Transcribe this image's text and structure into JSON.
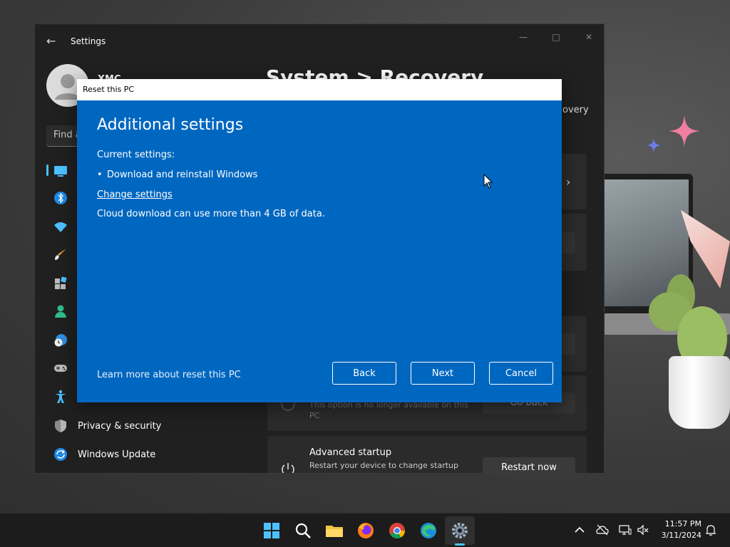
{
  "settings": {
    "title": "Settings",
    "user_name": "XMC",
    "search_placeholder": "Find a",
    "page_title": "System  >  Recovery",
    "breadcrumb_tail": "overy",
    "nav": [
      {
        "label": "",
        "icon": "system-icon"
      },
      {
        "label": "",
        "icon": "bluetooth-icon"
      },
      {
        "label": "",
        "icon": "wifi-icon"
      },
      {
        "label": "",
        "icon": "personalization-icon"
      },
      {
        "label": "",
        "icon": "apps-icon"
      },
      {
        "label": "",
        "icon": "accounts-icon"
      },
      {
        "label": "",
        "icon": "time-language-icon"
      },
      {
        "label": "",
        "icon": "gaming-icon"
      },
      {
        "label": "",
        "icon": "accessibility-icon"
      },
      {
        "label": "Privacy & security",
        "icon": "shield-icon"
      },
      {
        "label": "Windows Update",
        "icon": "windows-update-icon"
      }
    ],
    "go_back": {
      "desc": "This option is no longer available on this PC",
      "button": "Go back"
    },
    "advanced_startup": {
      "title": "Advanced startup",
      "desc": "Restart your device to change startup settings, including starting from a disc",
      "button": "Restart now"
    }
  },
  "dialog": {
    "title": "Reset this PC",
    "heading": "Additional settings",
    "current_label": "Current settings:",
    "bullet": "Download and reinstall Windows",
    "change_link": "Change settings",
    "cloud_note": "Cloud download can use more than 4 GB of data.",
    "learn_link": "Learn more about reset this PC",
    "buttons": {
      "back": "Back",
      "next": "Next",
      "cancel": "Cancel"
    }
  },
  "taskbar": {
    "time": "11:57 PM",
    "date": "3/11/2024",
    "accent": "#4cc2ff"
  },
  "colors": {
    "dialog_bg": "#0067c0",
    "window_bg": "#202020"
  }
}
